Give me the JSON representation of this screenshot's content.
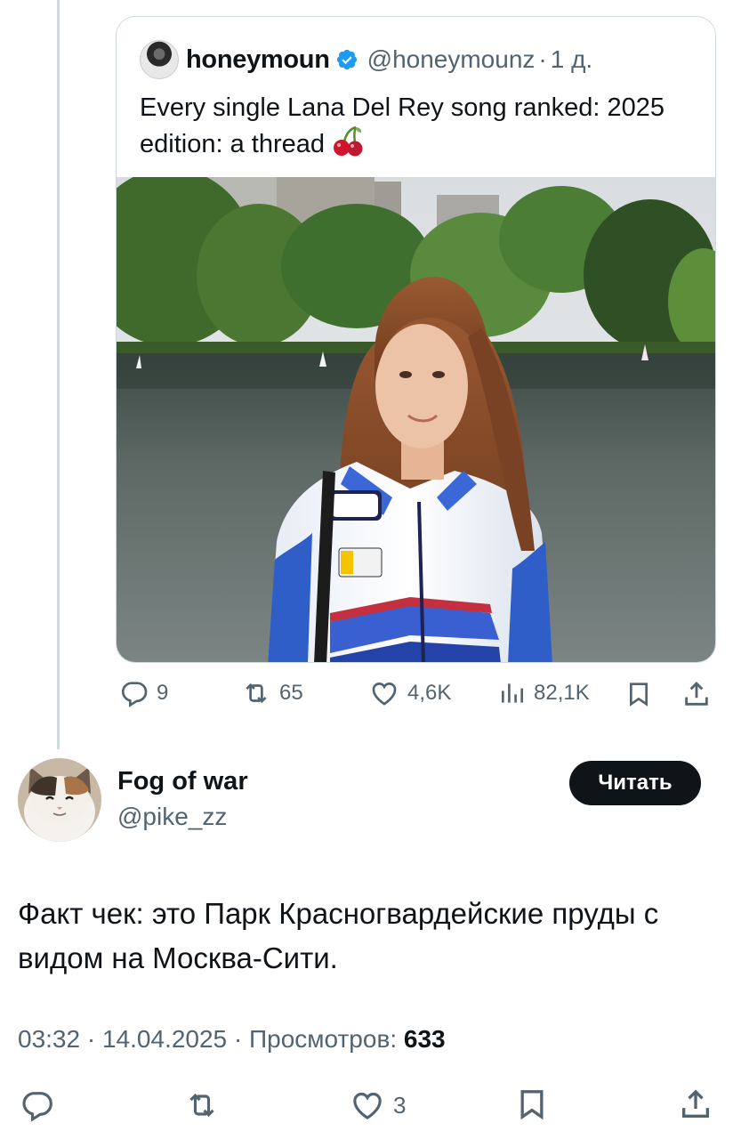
{
  "quoted_tweet": {
    "author_name": "honeymoun",
    "handle": "@honeymounz",
    "separator": "·",
    "time": "1 д.",
    "text": "Every single Lana Del Rey song ranked: 2025 edition: a thread",
    "emoji": "cherries-emoji",
    "actions": {
      "replies": "9",
      "reposts": "65",
      "likes": "4,6K",
      "views": "82,1K"
    }
  },
  "reply": {
    "author_name": "Fog of war",
    "handle": "@pike_zz",
    "follow_button": "Читать",
    "text": "Факт чек: это Парк Красногвардейские пруды с видом на Москва-Сити.",
    "time": "03:32",
    "date": "14.04.2025",
    "views_label": "Просмотров:",
    "views_count": "633",
    "separator": "·",
    "actions": {
      "replies": "",
      "reposts": "",
      "likes": "3"
    }
  },
  "colors": {
    "text": "#0f1419",
    "secondary": "#536471",
    "verified": "#1d9bf0",
    "border": "#cfd9de"
  }
}
